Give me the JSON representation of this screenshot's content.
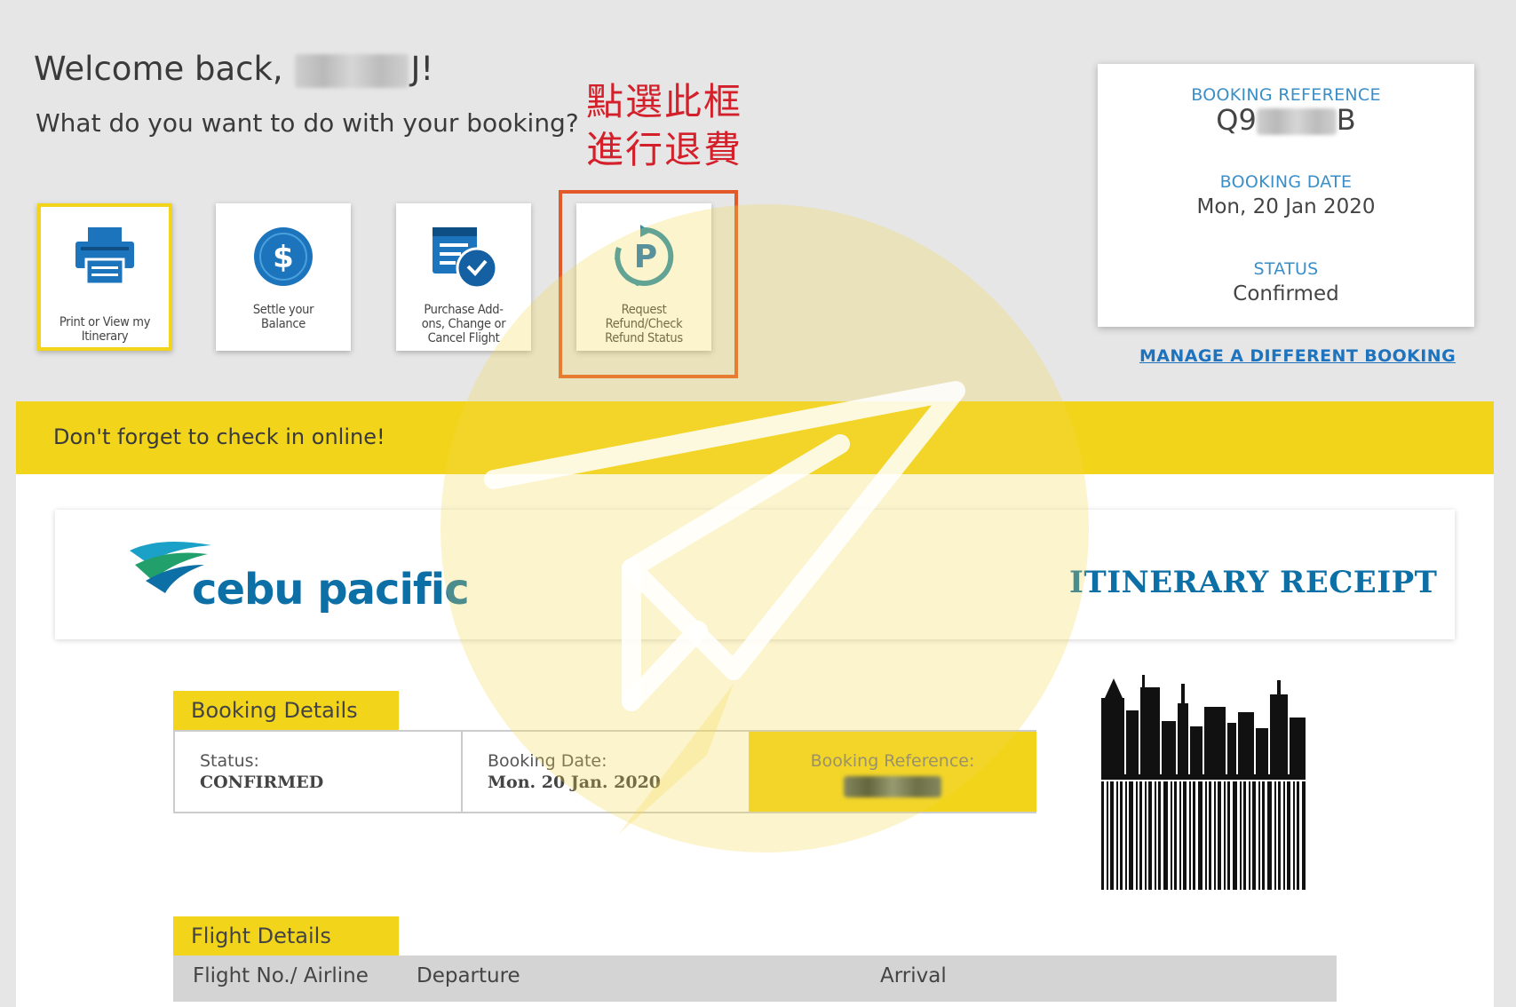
{
  "header": {
    "welcome_prefix": "Welcome back,",
    "welcome_suffix": "J!",
    "question": "What do you want to do with your booking?",
    "annotation_line1": "點選此框",
    "annotation_line2": "進行退費"
  },
  "actions": [
    {
      "label": "Print or View my\nItinerary",
      "icon": "printer-icon"
    },
    {
      "label": "Settle your\nBalance",
      "icon": "dollar-icon"
    },
    {
      "label": "Purchase Add-\nons, Change or\nCancel Flight",
      "icon": "calendar-clock-icon"
    },
    {
      "label": "Request\nRefund/Check\nRefund Status",
      "icon": "refund-icon"
    }
  ],
  "booking_panel": {
    "ref_label": "BOOKING REFERENCE",
    "ref_value": "Q9",
    "ref_value_end": "B",
    "date_label": "BOOKING DATE",
    "date_value": "Mon, 20 Jan 2020",
    "status_label": "STATUS",
    "status_value": "Confirmed",
    "manage_link": "MANAGE A DIFFERENT BOOKING"
  },
  "banner": {
    "checkin_text": "Don't forget to check in online!"
  },
  "itinerary": {
    "logo_text": "cebu pacific",
    "title": "ITINERARY RECEIPT",
    "booking_details": {
      "heading": "Booking Details",
      "status_label": "Status:",
      "status_value": "CONFIRMED",
      "date_label": "Booking Date:",
      "date_value": "Mon. 20 Jan. 2020",
      "ref_label": "Booking Reference:"
    },
    "flight_details": {
      "heading": "Flight Details",
      "columns": [
        "Flight No./ Airline",
        "Departure",
        "Arrival"
      ]
    }
  },
  "colors": {
    "brand_yellow": "#f2d51b",
    "brand_blue": "#0c6fa6",
    "link_blue": "#1e73be",
    "annotation_red": "#d3202a",
    "highlight_orange": "#e25a2a"
  }
}
